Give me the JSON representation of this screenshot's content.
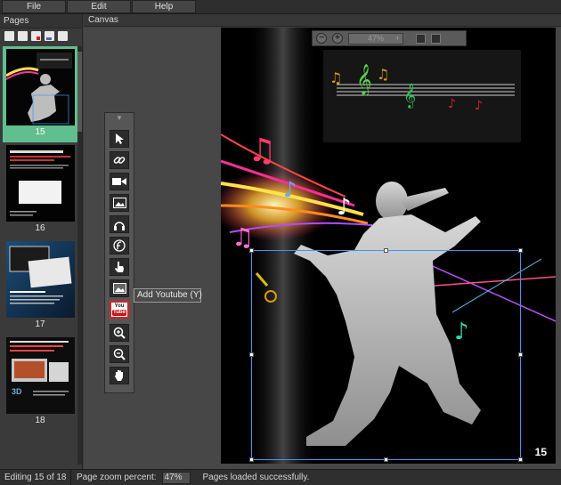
{
  "menu": {
    "file": "File",
    "edit": "Edit",
    "help": "Help"
  },
  "pages_panel": {
    "title": "Pages",
    "pages": [
      {
        "number": "15",
        "active": true
      },
      {
        "number": "16",
        "active": false
      },
      {
        "number": "17",
        "active": false
      },
      {
        "number": "18",
        "active": false
      }
    ]
  },
  "canvas": {
    "title": "Canvas",
    "zoom_display": "47%",
    "zoom_plus": "+",
    "page_number_badge": "15"
  },
  "toolbox": {
    "tools": [
      "select-arrow-icon",
      "link-icon",
      "video-icon",
      "image-icon",
      "audio-headphones-icon",
      "flash-icon",
      "hand-pointer-icon",
      "picture-icon",
      "youtube-icon",
      "zoom-in-icon",
      "zoom-out-icon",
      "pan-hand-icon"
    ],
    "youtube_you": "You",
    "youtube_tube": "Tube",
    "tooltip": "Add Youtube (Y)"
  },
  "statusbar": {
    "editing": "Editing 15 of 18",
    "zoom_label": "Page zoom percent:",
    "zoom_value": "47%",
    "message": "Pages loaded successfully."
  },
  "colors": {
    "active_page": "#5fbf8e",
    "selection": "#3c95ff",
    "youtube_red": "#e02020"
  }
}
